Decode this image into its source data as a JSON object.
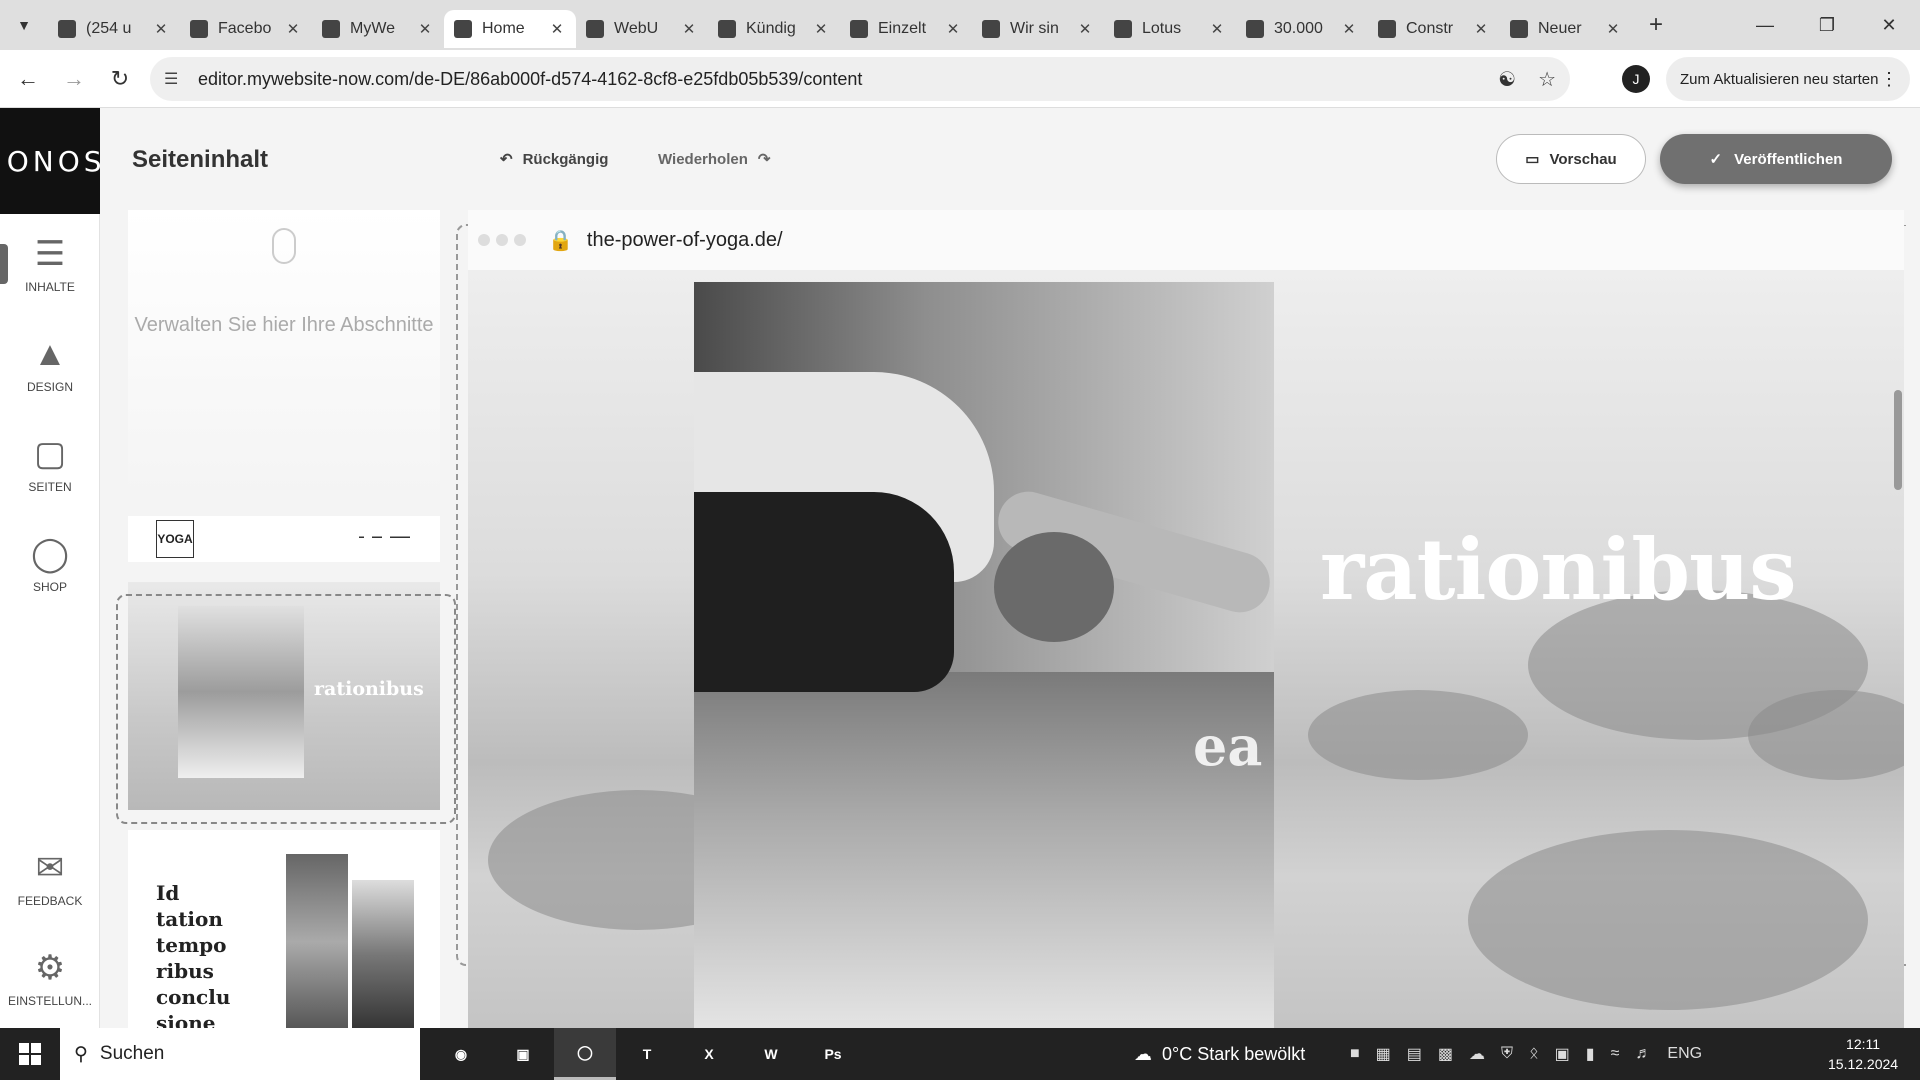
{
  "browser": {
    "tabs": [
      {
        "label": "(254 u",
        "icon": "mail-icon"
      },
      {
        "label": "Facebo",
        "icon": "facebook-icon"
      },
      {
        "label": "MyWe",
        "icon": "mywebsite-icon"
      },
      {
        "label": "Home",
        "icon": "mywebsite-icon",
        "active": true
      },
      {
        "label": "WebU",
        "icon": "webui-icon"
      },
      {
        "label": "Kündig",
        "icon": "globe-icon"
      },
      {
        "label": "Einzelt",
        "icon": "site-icon"
      },
      {
        "label": "Wir sin",
        "icon": "site-icon"
      },
      {
        "label": "Lotus",
        "icon": "st-icon"
      },
      {
        "label": "30.000",
        "icon": "px-icon"
      },
      {
        "label": "Constr",
        "icon": "construct-icon"
      },
      {
        "label": "Neuer",
        "icon": "chrome-icon"
      }
    ],
    "url": "editor.mywebsite-now.com/de-DE/86ab000f-d574-4162-8cf8-e25fdb05b539/content",
    "profile_initial": "J",
    "update_button": "Zum Aktualisieren neu starten"
  },
  "editor": {
    "logo": "IONOS",
    "rail": [
      {
        "label": "INHALTE",
        "icon": "content-icon",
        "active": true
      },
      {
        "label": "DESIGN",
        "icon": "design-icon"
      },
      {
        "label": "SEITEN",
        "icon": "pages-icon"
      },
      {
        "label": "SHOP",
        "icon": "cart-icon"
      }
    ],
    "rail_bottom": [
      {
        "label": "FEEDBACK",
        "icon": "feedback-icon"
      },
      {
        "label": "EINSTELLUN...",
        "icon": "gear-icon"
      }
    ],
    "page_title": "Seiteninhalt",
    "undo_label": "Rückgängig",
    "redo_label": "Wiederholen",
    "preview_label": "Vorschau",
    "publish_label": "Veröffentlichen",
    "sections_hint": "Verwalten Sie hier Ihre Abschnitte",
    "thumb_logo": "YOGA",
    "thumb_hero_word": "rationibus",
    "thumb_text_heading": "Id tation tempo ribus conclu sione"
  },
  "site": {
    "url": "the-power-of-yoga.de/",
    "hero_word": "rationibus",
    "hero_sub": "ea"
  },
  "taskbar": {
    "search_label": "Suchen",
    "weather": "0°C  Stark bewölkt",
    "lang": "ENG",
    "time": "12:11",
    "date": "15.12.2024"
  }
}
